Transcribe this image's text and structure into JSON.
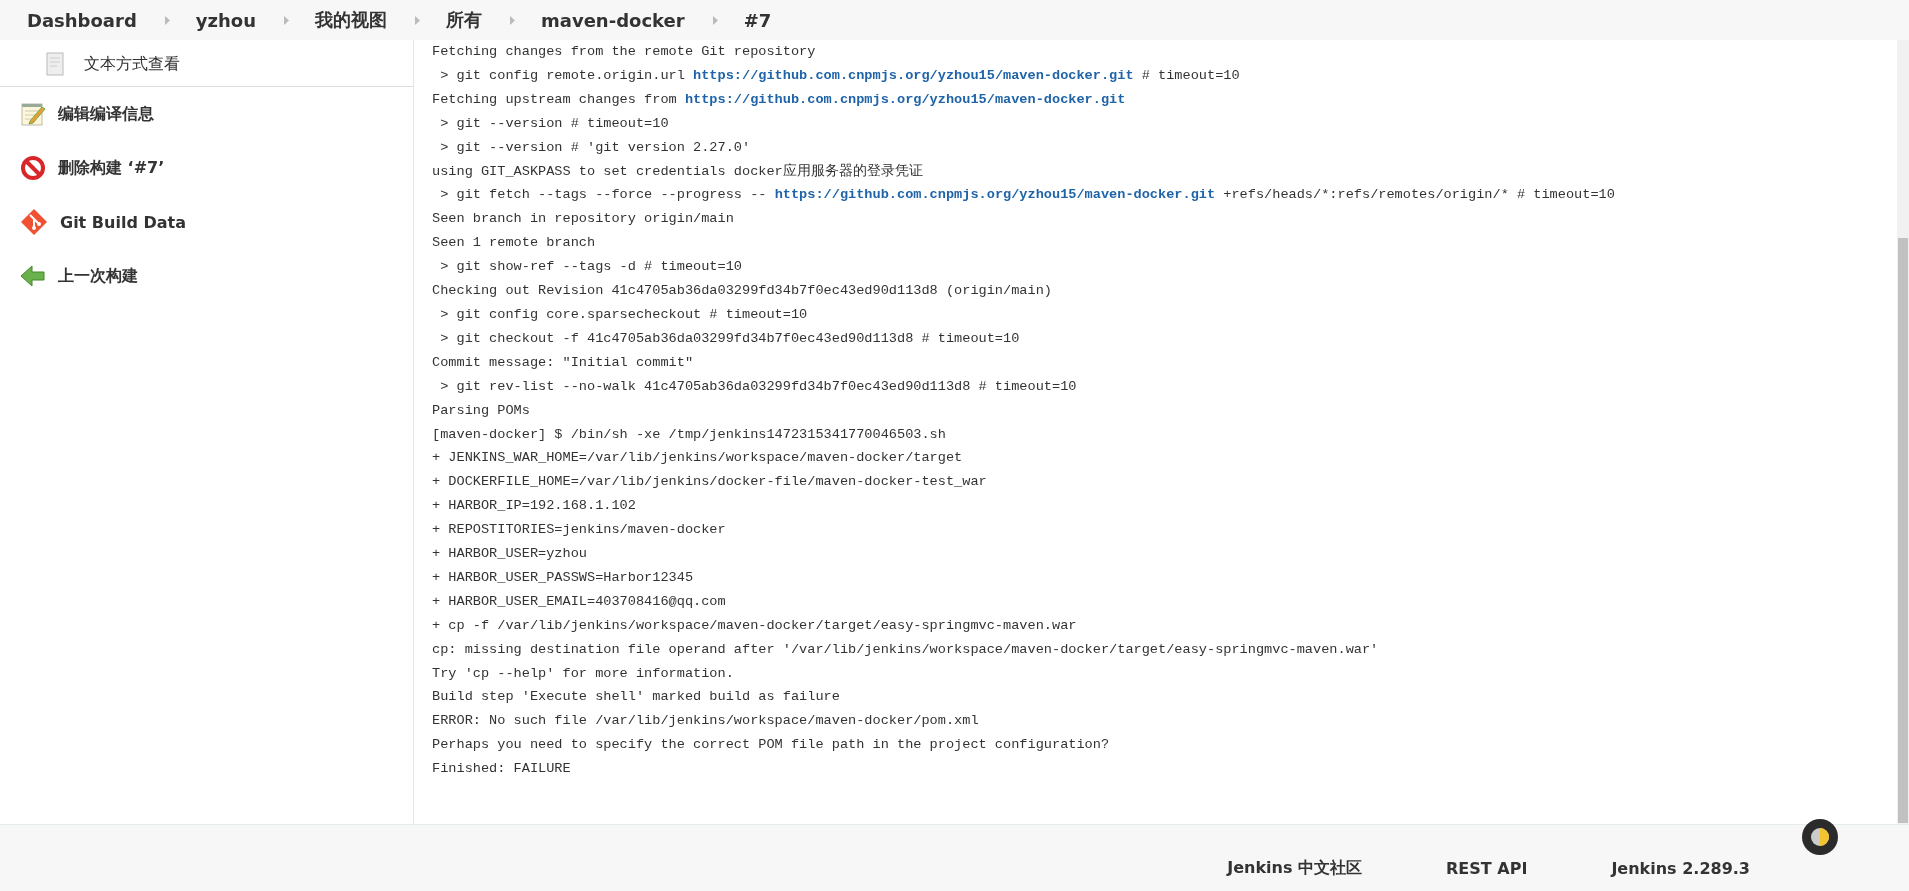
{
  "breadcrumbs": [
    {
      "label": "Dashboard"
    },
    {
      "label": "yzhou"
    },
    {
      "label": "我的视图"
    },
    {
      "label": "所有"
    },
    {
      "label": "maven-docker"
    },
    {
      "label": "#7"
    }
  ],
  "sidebar": {
    "items": [
      {
        "label": "文本方式查看",
        "kind": "document",
        "sub": true
      },
      {
        "label": "编辑编译信息",
        "kind": "edit",
        "sub": false
      },
      {
        "label": "删除构建 ‘#7’",
        "kind": "delete",
        "sub": false
      },
      {
        "label": "Git Build Data",
        "kind": "git",
        "sub": false
      },
      {
        "label": "上一次构建",
        "kind": "back",
        "sub": false
      }
    ]
  },
  "console": {
    "lines": [
      [
        {
          "text": "Fetching changes from the remote Git repository"
        }
      ],
      [
        {
          "text": " > git config remote.origin.url "
        },
        {
          "text": "https://github.com.cnpmjs.org/yzhou15/maven-docker.git",
          "link": true
        },
        {
          "text": " # timeout=10"
        }
      ],
      [
        {
          "text": "Fetching upstream changes from "
        },
        {
          "text": "https://github.com.cnpmjs.org/yzhou15/maven-docker.git",
          "link": true
        }
      ],
      [
        {
          "text": " > git --version # timeout=10"
        }
      ],
      [
        {
          "text": " > git --version # 'git version 2.27.0'"
        }
      ],
      [
        {
          "text": "using GIT_ASKPASS to set credentials docker应用服务器的登录凭证"
        }
      ],
      [
        {
          "text": " > git fetch --tags --force --progress -- "
        },
        {
          "text": "https://github.com.cnpmjs.org/yzhou15/maven-docker.git",
          "link": true
        },
        {
          "text": " +refs/heads/*:refs/remotes/origin/* # timeout=10"
        }
      ],
      [
        {
          "text": "Seen branch in repository origin/main"
        }
      ],
      [
        {
          "text": "Seen 1 remote branch"
        }
      ],
      [
        {
          "text": " > git show-ref --tags -d # timeout=10"
        }
      ],
      [
        {
          "text": "Checking out Revision 41c4705ab36da03299fd34b7f0ec43ed90d113d8 (origin/main)"
        }
      ],
      [
        {
          "text": " > git config core.sparsecheckout # timeout=10"
        }
      ],
      [
        {
          "text": " > git checkout -f 41c4705ab36da03299fd34b7f0ec43ed90d113d8 # timeout=10"
        }
      ],
      [
        {
          "text": "Commit message: \"Initial commit\""
        }
      ],
      [
        {
          "text": " > git rev-list --no-walk 41c4705ab36da03299fd34b7f0ec43ed90d113d8 # timeout=10"
        }
      ],
      [
        {
          "text": "Parsing POMs"
        }
      ],
      [
        {
          "text": "[maven-docker] $ /bin/sh -xe /tmp/jenkins1472315341770046503.sh"
        }
      ],
      [
        {
          "text": "+ JENKINS_WAR_HOME=/var/lib/jenkins/workspace/maven-docker/target"
        }
      ],
      [
        {
          "text": "+ DOCKERFILE_HOME=/var/lib/jenkins/docker-file/maven-docker-test_war"
        }
      ],
      [
        {
          "text": "+ HARBOR_IP=192.168.1.102"
        }
      ],
      [
        {
          "text": "+ REPOSTITORIES=jenkins/maven-docker"
        }
      ],
      [
        {
          "text": "+ HARBOR_USER=yzhou"
        }
      ],
      [
        {
          "text": "+ HARBOR_USER_PASSWS=Harbor12345"
        }
      ],
      [
        {
          "text": "+ HARBOR_USER_EMAIL=403708416@qq.com"
        }
      ],
      [
        {
          "text": "+ cp -f /var/lib/jenkins/workspace/maven-docker/target/easy-springmvc-maven.war"
        }
      ],
      [
        {
          "text": "cp: missing destination file operand after '/var/lib/jenkins/workspace/maven-docker/target/easy-springmvc-maven.war'"
        }
      ],
      [
        {
          "text": "Try 'cp --help' for more information."
        }
      ],
      [
        {
          "text": "Build step 'Execute shell' marked build as failure"
        }
      ],
      [
        {
          "text": "ERROR: No such file /var/lib/jenkins/workspace/maven-docker/pom.xml"
        }
      ],
      [
        {
          "text": "Perhaps you need to specify the correct POM file path in the project configuration?"
        }
      ],
      [
        {
          "text": "Finished: FAILURE"
        }
      ]
    ]
  },
  "footer": {
    "links": [
      {
        "label": "Jenkins 中文社区"
      },
      {
        "label": "REST API"
      },
      {
        "label": "Jenkins 2.289.3"
      }
    ]
  }
}
